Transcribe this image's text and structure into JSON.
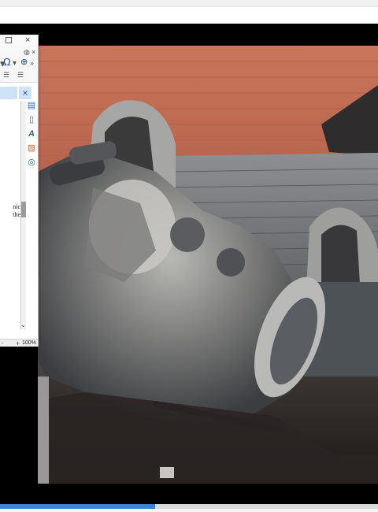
{
  "editor": {
    "close_glyph": "×",
    "ribbon": {
      "symbol_glyph": "Ω",
      "dropdown_glyph": "▾",
      "more_glyph": "»",
      "side_close_glyph": "×"
    },
    "panel_close_glyph": "×",
    "doc_lines": [
      "nic",
      "the"
    ],
    "scroll_down_glyph": "⌄",
    "status": {
      "zoom_minus": "-",
      "zoom_plus": "+",
      "zoom_level": "100%"
    },
    "icons": [
      "styles-icon",
      "page-icon",
      "font-icon",
      "image-icon",
      "navigator-icon"
    ]
  },
  "player": {
    "progress_fraction": 0.41,
    "accent": "#3c82d8"
  }
}
